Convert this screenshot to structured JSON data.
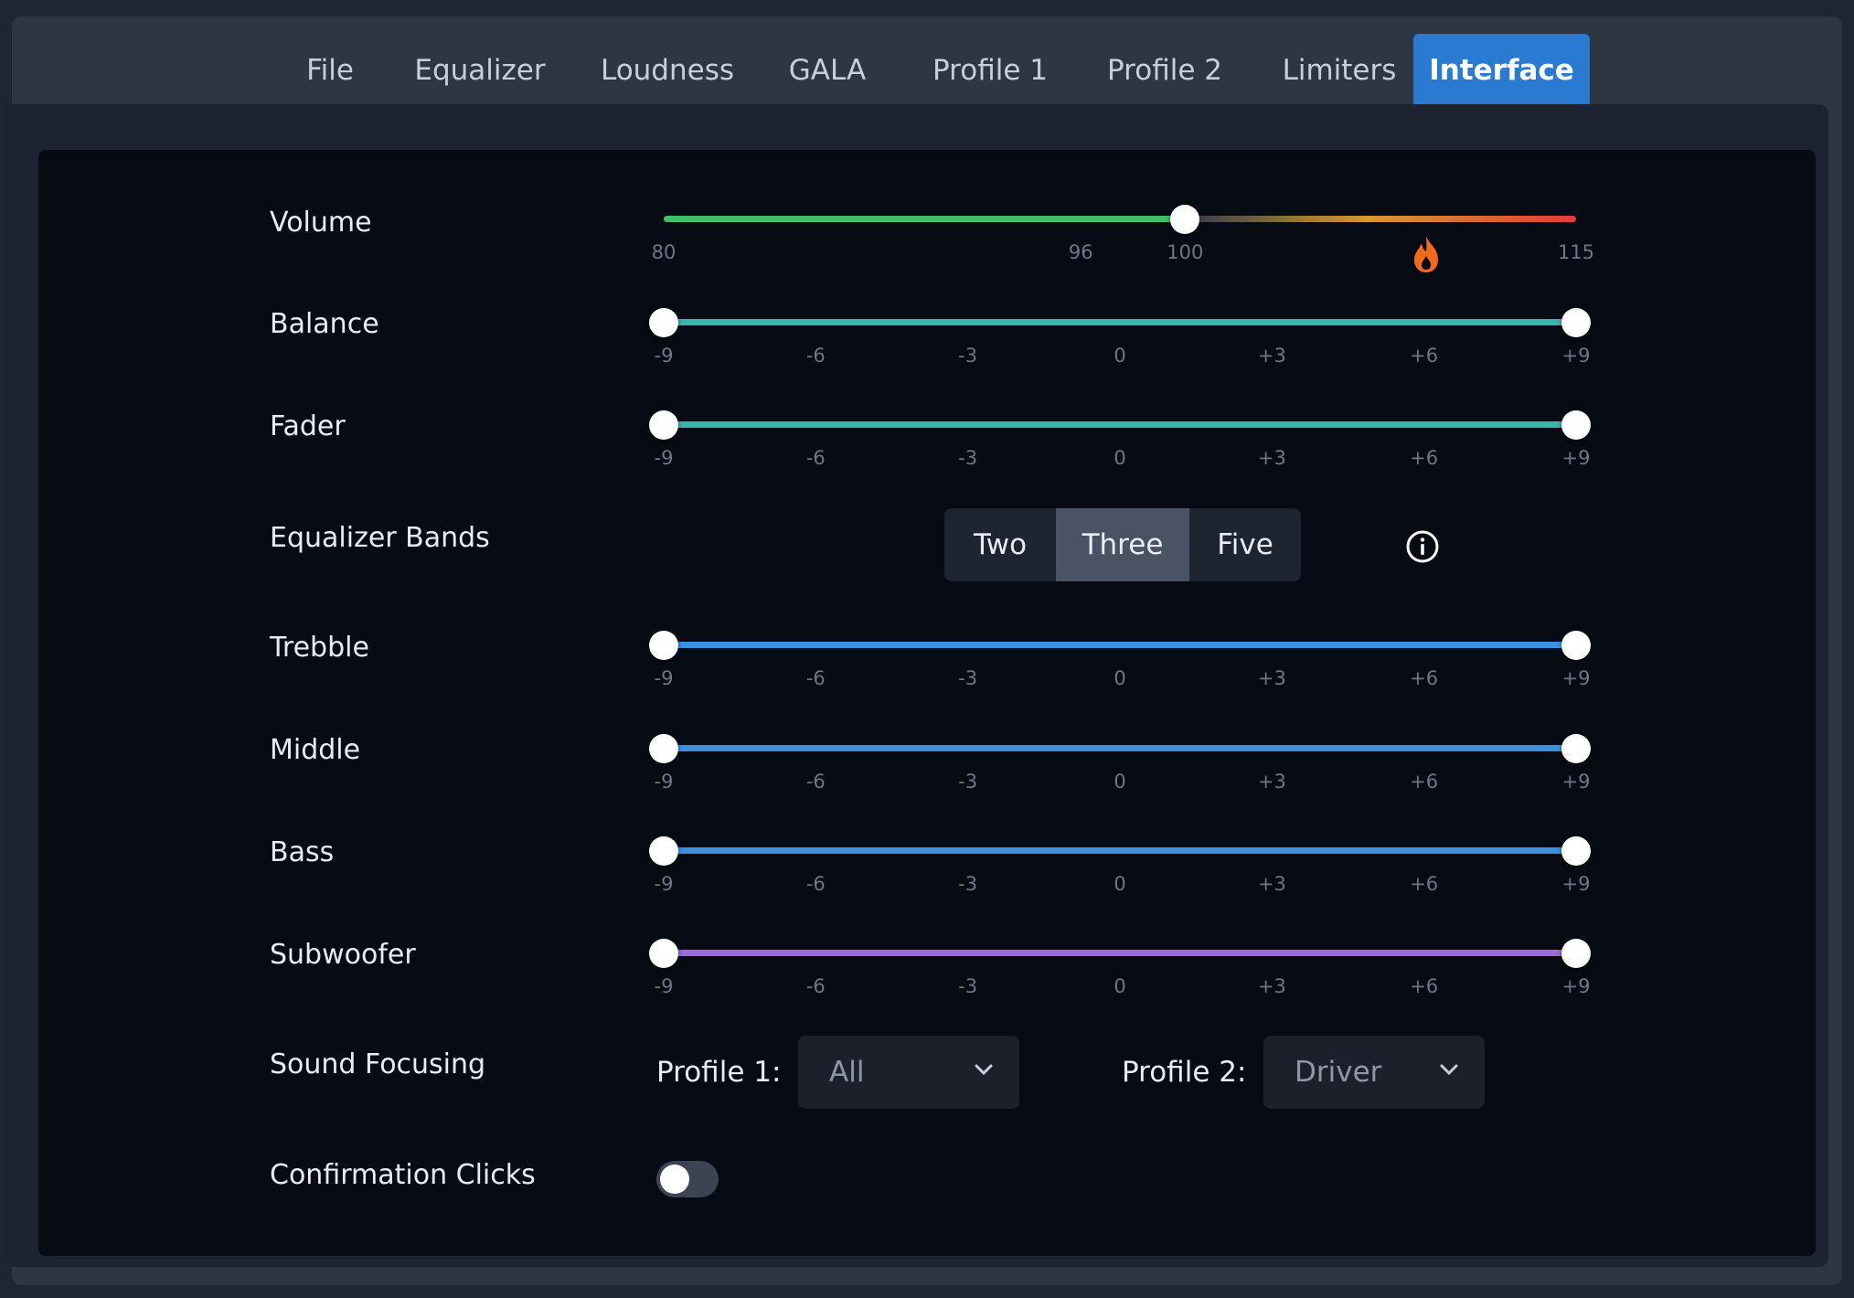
{
  "tabs": [
    {
      "label": "File",
      "active": false
    },
    {
      "label": "Equalizer",
      "active": false
    },
    {
      "label": "Loudness",
      "active": false
    },
    {
      "label": "GALA",
      "active": false
    },
    {
      "label": "Profile 1",
      "active": false
    },
    {
      "label": "Profile 2",
      "active": false
    },
    {
      "label": "Limiters",
      "active": false
    },
    {
      "label": "Interface",
      "active": true
    }
  ],
  "volume": {
    "label": "Volume",
    "min": 80,
    "max": 115,
    "value": 100,
    "ticks": [
      "80",
      "96",
      "100",
      "115"
    ],
    "flame_icon": "flame-icon"
  },
  "balance": {
    "label": "Balance",
    "range_low": -9,
    "range_high": 9
  },
  "fader": {
    "label": "Fader",
    "range_low": -9,
    "range_high": 9
  },
  "eq_bands": {
    "label": "Equalizer Bands",
    "options": [
      "Two",
      "Three",
      "Five"
    ],
    "selected": "Three",
    "info_icon": "info-icon"
  },
  "trebble": {
    "label": "Trebble",
    "range_low": -9,
    "range_high": 9
  },
  "middle": {
    "label": "Middle",
    "range_low": -9,
    "range_high": 9
  },
  "bass": {
    "label": "Bass",
    "range_low": -9,
    "range_high": 9
  },
  "subwoofer": {
    "label": "Subwoofer",
    "range_low": -9,
    "range_high": 9
  },
  "slider_ticks": [
    "-9",
    "-6",
    "-3",
    "0",
    "+3",
    "+6",
    "+9"
  ],
  "sound_focusing": {
    "label": "Sound Focusing",
    "profile1_label": "Profile 1:",
    "profile1_value": "All",
    "profile2_label": "Profile 2:",
    "profile2_value": "Driver"
  },
  "confirmation_clicks": {
    "label": "Confirmation Clicks",
    "enabled": false
  },
  "colors": {
    "accent": "#2a7ad2",
    "balance_track": "#3ab6ac",
    "eq_track": "#3d8fe0",
    "sub_track": "#9a6ae0",
    "volume_low": "#3fbf6a",
    "volume_high": "#e33b3b",
    "flame": "#f26a1b"
  }
}
